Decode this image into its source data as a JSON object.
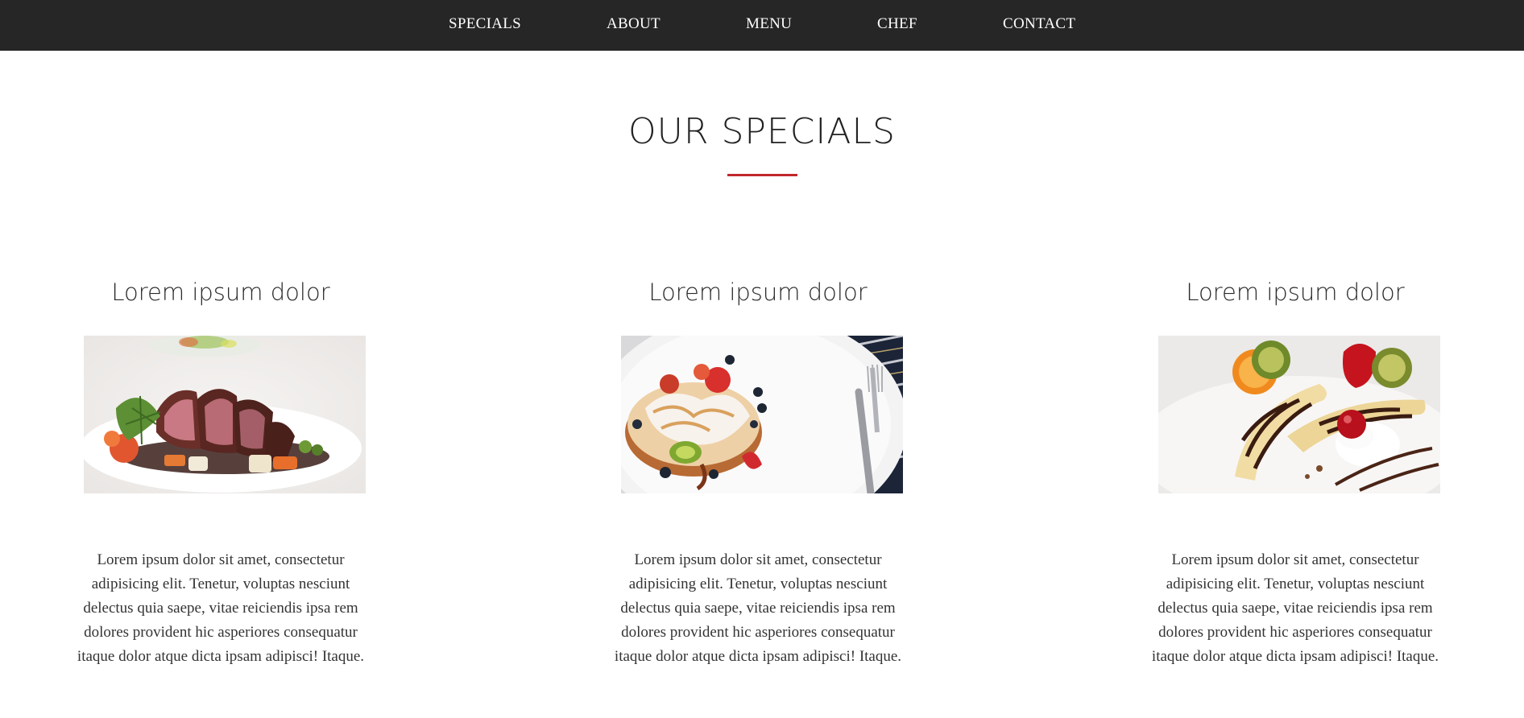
{
  "nav": {
    "items": [
      {
        "label": "SPECIALS"
      },
      {
        "label": "ABOUT"
      },
      {
        "label": "MENU"
      },
      {
        "label": "CHEF"
      },
      {
        "label": "CONTACT"
      }
    ]
  },
  "section": {
    "title": "OUR SPECIALS",
    "accent_color": "#c0282d"
  },
  "cards": [
    {
      "title": "Lorem ipsum dolor",
      "image": "sliced-steak-with-vegetables-photo",
      "text": "Lorem ipsum dolor sit amet, consectetur adipisicing elit. Tenetur, voluptas nesciunt delectus quia saepe, vitae reiciendis ipsa rem dolores provident hic asperiores consequatur itaque dolor atque dicta ipsam adipisci! Itaque."
    },
    {
      "title": "Lorem ipsum dolor",
      "image": "pancakes-with-berries-photo",
      "text": "Lorem ipsum dolor sit amet, consectetur adipisicing elit. Tenetur, voluptas nesciunt delectus quia saepe, vitae reiciendis ipsa rem dolores provident hic asperiores consequatur itaque dolor atque dicta ipsam adipisci! Itaque."
    },
    {
      "title": "Lorem ipsum dolor",
      "image": "banana-split-dessert-photo",
      "text": "Lorem ipsum dolor sit amet, consectetur adipisicing elit. Tenetur, voluptas nesciunt delectus quia saepe, vitae reiciendis ipsa rem dolores provident hic asperiores consequatur itaque dolor atque dicta ipsam adipisci! Itaque."
    }
  ]
}
